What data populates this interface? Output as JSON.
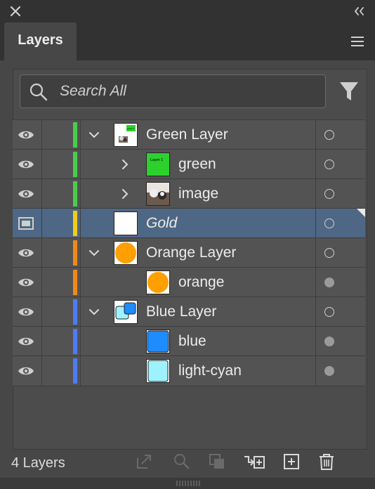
{
  "panel": {
    "tab_label": "Layers"
  },
  "search": {
    "placeholder": "Search All",
    "value": ""
  },
  "rows": [
    {
      "label": "Green Layer",
      "color": "#4ccc4c",
      "visible": true,
      "expanded": true,
      "level": 0,
      "thumb": "green-layer-thumbnail",
      "thumb_text": "Layer 1"
    },
    {
      "label": "green",
      "color": "#4ccc4c",
      "visible": true,
      "expanded": false,
      "level": 1,
      "thumb": "green-thumbnail",
      "thumb_text": "Layer 1"
    },
    {
      "label": "image",
      "color": "#4ccc4c",
      "visible": true,
      "expanded": false,
      "level": 1,
      "thumb": "image-thumbnail"
    },
    {
      "label": "Gold",
      "color": "#f2cb1b",
      "visible": "template",
      "level": 0,
      "selected": true,
      "italic": true,
      "thumb": "gold-thumbnail"
    },
    {
      "label": "Orange Layer",
      "color": "#f08a1a",
      "visible": true,
      "expanded": true,
      "level": 0,
      "thumb": "orange-layer-thumbnail"
    },
    {
      "label": "orange",
      "color": "#f08a1a",
      "visible": true,
      "level": 1,
      "thumb": "orange-thumbnail"
    },
    {
      "label": "Blue Layer",
      "color": "#4f7cf2",
      "visible": true,
      "expanded": true,
      "level": 0,
      "thumb": "blue-layer-thumbnail"
    },
    {
      "label": "blue",
      "color": "#4f7cf2",
      "visible": true,
      "level": 1,
      "thumb": "blue-thumbnail"
    },
    {
      "label": "light-cyan",
      "color": "#4f7cf2",
      "visible": true,
      "level": 1,
      "thumb": "light-cyan-thumbnail"
    }
  ],
  "footer": {
    "count_label": "4 Layers",
    "icons": [
      "collect-for-export-icon",
      "locate-object-icon",
      "make-clipping-mask-icon",
      "create-sublayer-icon",
      "create-layer-icon",
      "delete-icon"
    ]
  }
}
